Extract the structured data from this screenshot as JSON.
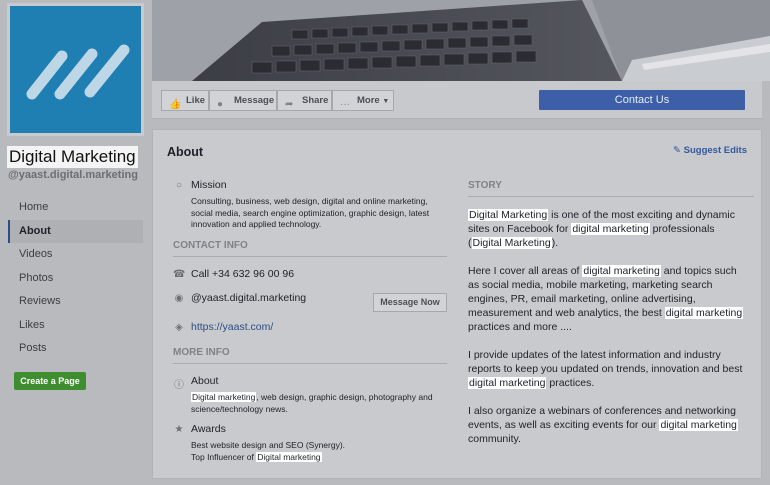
{
  "page": {
    "name": "Digital Marketing",
    "handle": "@yaast.digital.marketing",
    "brand_color": "#1f7fb3"
  },
  "nav": {
    "items": [
      {
        "label": "Home"
      },
      {
        "label": "About"
      },
      {
        "label": "Videos"
      },
      {
        "label": "Photos"
      },
      {
        "label": "Reviews"
      },
      {
        "label": "Likes"
      },
      {
        "label": "Posts"
      }
    ],
    "active": "About",
    "create_page": "Create a Page"
  },
  "actions": {
    "like": "Like",
    "message": "Message",
    "share": "Share",
    "more": "More",
    "contact": "Contact Us"
  },
  "about": {
    "title": "About",
    "suggest_edits": "Suggest Edits",
    "mission": {
      "title": "Mission",
      "text": "Consulting, business, web design, digital and online marketing, social media, search engine optimization, graphic design, latest innovation and applied technology."
    },
    "contact_info": {
      "heading": "CONTACT INFO",
      "phone": "Call +34 632 96 00 96",
      "messenger": "@yaast.digital.marketing",
      "message_now": "Message Now",
      "website": "https://yaast.com/"
    },
    "more_info": {
      "heading": "MORE INFO",
      "about_title": "About",
      "about_highlight": "Digital marketing",
      "about_rest": ", web design, graphic design, photography and science/technology news.",
      "awards_title": "Awards",
      "awards_line1": "Best website design and SEO (Synergy).",
      "awards_line2_prefix": "Top Influencer of ",
      "awards_line2_highlight": "Digital marketing"
    },
    "story": {
      "heading": "STORY",
      "p1": {
        "h1": "Digital Marketing",
        "t1": " is one of the most exciting and dynamic sites on Facebook for ",
        "h2": "digital marketing",
        "t2": " professionals (",
        "h3": "Digital Marketing",
        "t3": ")."
      },
      "p2": {
        "t1": "Here I cover all areas of ",
        "h1": "digital marketing",
        "t2": " and topics such as social media, mobile marketing, marketing search engines, PR, email marketing, online advertising, measurement and web analytics, the best ",
        "h2": "digital marketing",
        "t3": " practices and more ...."
      },
      "p3": {
        "t1": "I provide updates of the latest information and industry reports to keep you updated on trends, innovation and best ",
        "h1": "digital marketing",
        "t2": " practices."
      },
      "p4": {
        "t1": "I also organize a webinars of conferences and networking events, as well as exciting events for our ",
        "h1": "digital marketing",
        "t2": " community."
      }
    }
  },
  "icons": {
    "mission": "compass-icon",
    "phone": "phone-icon",
    "messenger": "messenger-icon",
    "website": "globe-icon",
    "info": "info-icon",
    "awards": "trophy-icon"
  }
}
